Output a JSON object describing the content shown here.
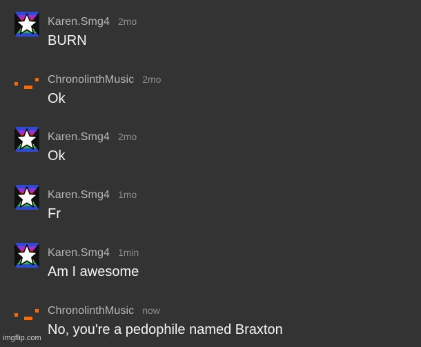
{
  "comments": [
    {
      "username": "Karen.Smg4",
      "time": "2mo",
      "text": "BURN",
      "avatar": "rainbow-star-icon"
    },
    {
      "username": "ChronolinthMusic",
      "time": "2mo",
      "text": "Ok",
      "avatar": "orange-squares-icon"
    },
    {
      "username": "Karen.Smg4",
      "time": "2mo",
      "text": "Ok",
      "avatar": "rainbow-star-icon"
    },
    {
      "username": "Karen.Smg4",
      "time": "1mo",
      "text": "Fr",
      "avatar": "rainbow-star-icon"
    },
    {
      "username": "Karen.Smg4",
      "time": "1min",
      "text": "Am I awesome",
      "avatar": "rainbow-star-icon"
    },
    {
      "username": "ChronolinthMusic",
      "time": "now",
      "text": "No, you're a pedophile named Braxton",
      "avatar": "orange-squares-icon"
    }
  ],
  "watermark": "imgflip.com",
  "colors": {
    "background": "#333333",
    "username": "#b8b8b8",
    "timestamp": "#8e8e8e",
    "message": "#f4f4f4",
    "accent_orange": "#ff6a00"
  }
}
